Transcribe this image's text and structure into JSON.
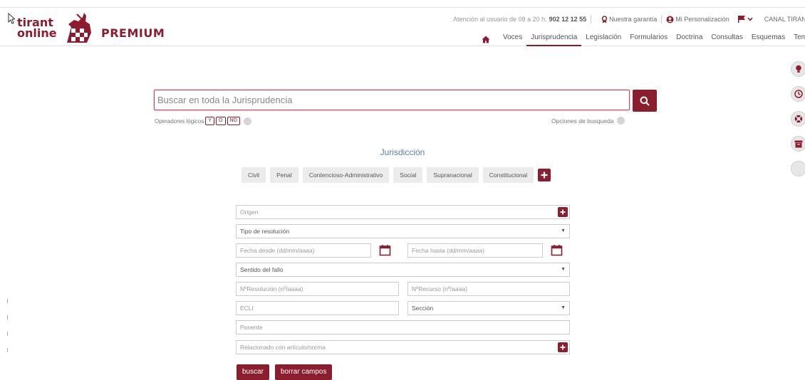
{
  "header": {
    "logo_line1": "tirant",
    "logo_line2": "online",
    "product": "PREMIUM",
    "attention_text": "Atención al usuario de 08 a 20 h.",
    "phone": "902 12 12 55",
    "guarantee": "Nuestra garantía",
    "personalization": "Mi Personalización",
    "channel": "CANAL TIRANT"
  },
  "nav": {
    "items": [
      "Voces",
      "Jurisprudencia",
      "Legislación",
      "Formularios",
      "Doctrina",
      "Consultas",
      "Esquemas",
      "Temas"
    ],
    "active": "Jurisprudencia"
  },
  "search": {
    "placeholder": "Buscar en toda la Jurisprudencia",
    "operators_label": "Operadores lógicos",
    "operators": [
      "Y",
      "O",
      "NO"
    ],
    "options_label": "Opciones de busqueda"
  },
  "jurisdiction": {
    "title": "Jurisdicción",
    "tabs": [
      "Civil",
      "Penal",
      "Contencioso-Administrativo",
      "Social",
      "Supranacional",
      "Constitucional"
    ]
  },
  "form": {
    "origen": "Origen",
    "tipo_resolucion": "Tipo de resolución",
    "fecha_desde": "Fecha desde (dd/mm/aaaa)",
    "fecha_hasta": "Fecha hasta (dd/mm/aaaa)",
    "sentido_fallo": "Sentido del fallo",
    "num_resolucion": "NºResolución (nº/aaaa)",
    "num_recurso": "NºRecurso (nº/aaaa)",
    "ecli": "ECLI",
    "seccion": "Sección",
    "ponente": "Ponente",
    "relacionado": "Relacionado con artículo/norma"
  },
  "buttons": {
    "search": "buscar",
    "clear": "borrar campos"
  },
  "colors": {
    "brand": "#8c1d2e",
    "link_blue": "#5b7fa6"
  }
}
